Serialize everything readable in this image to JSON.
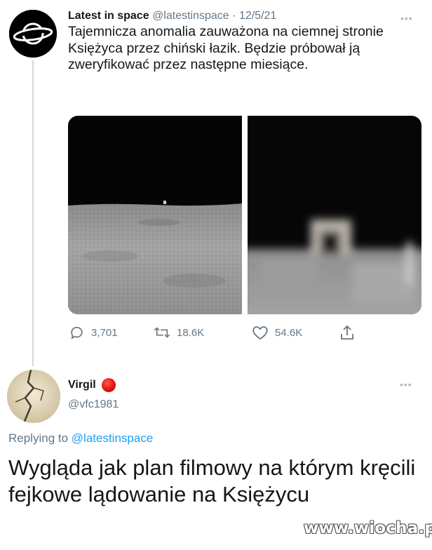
{
  "tweet": {
    "author_name": "Latest in space",
    "author_handle": "@latestinspace",
    "separator": "·",
    "date": "12/5/21",
    "more_icon": "ellipsis-icon",
    "text": "Tajemnicza anomalia zauważona na ciemnej stronie Księżyca przez chiński łazik. Będzie próbował ją zweryfikować przez następne miesiące.",
    "media": [
      {
        "icon": "moon-surface-photo",
        "description_visible": false
      },
      {
        "icon": "zoomed-anomaly-photo",
        "description_visible": false
      }
    ],
    "actions": {
      "replies": "3,701",
      "retweets": "18.6K",
      "likes": "54.6K",
      "share_icon": "share-icon"
    }
  },
  "reply": {
    "author_name": "Virgil",
    "badge_color": "#e0140e",
    "author_handle": "@vfc1981",
    "replying_prefix": "Replying to",
    "replying_mention": "@latestinspace",
    "text": "Wygląda jak plan filmowy na którym kręcili fejkowe lądowanie na Księżycu"
  },
  "watermark": "www.wiocha.pl",
  "colors": {
    "text": "#14171a",
    "muted": "#657786",
    "link": "#1da1f2",
    "thread_line": "#cfd9de"
  }
}
